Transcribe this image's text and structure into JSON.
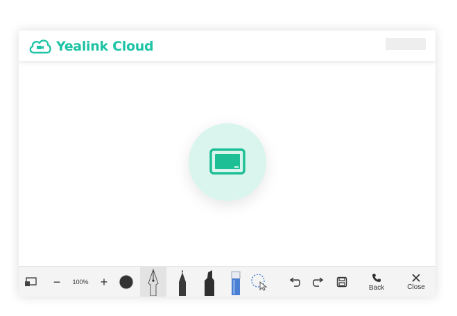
{
  "app": {
    "title": "Yealink Cloud",
    "brand_color": "#1dc3a4",
    "accent_color": "#1fbf95",
    "circle_bg": "#d9f5ee"
  },
  "toolbar": {
    "share_icon": "screen-share-icon",
    "zoom_out": "−",
    "zoom_level": "100%",
    "zoom_in": "+",
    "color_value": "#333333",
    "tools": [
      "fountain-pen",
      "pen",
      "marker",
      "eraser",
      "lasso-select"
    ],
    "selected_tool": "fountain-pen",
    "undo_icon": "undo-icon",
    "redo_icon": "redo-icon",
    "save_icon": "save-icon",
    "back_label": "Back",
    "close_label": "Close"
  }
}
